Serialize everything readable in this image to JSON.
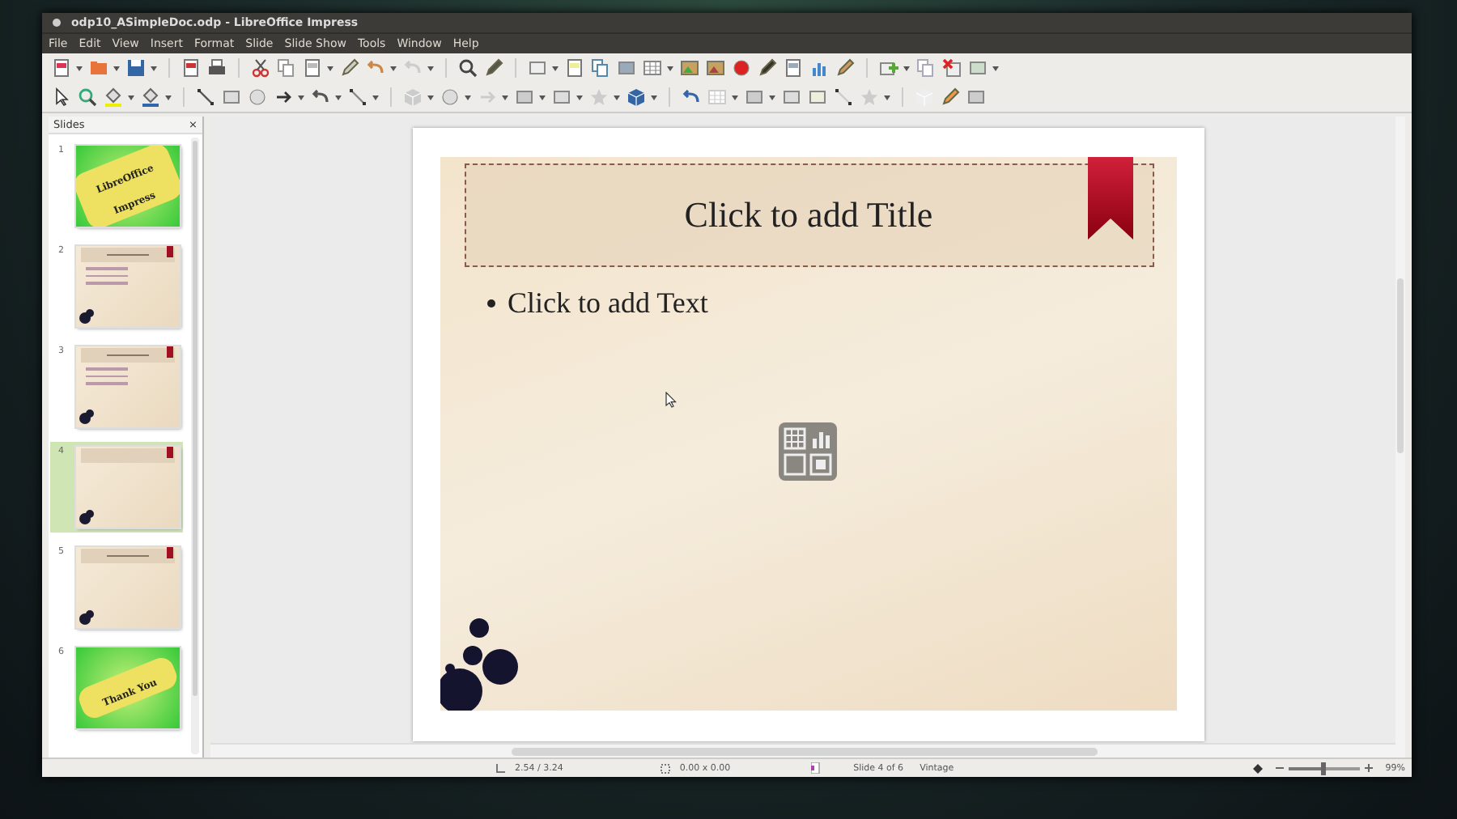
{
  "window": {
    "title": "odp10_ASimpleDoc.odp - LibreOffice Impress"
  },
  "menu": [
    "File",
    "Edit",
    "View",
    "Insert",
    "Format",
    "Slide",
    "Slide Show",
    "Tools",
    "Window",
    "Help"
  ],
  "slides_pane": {
    "title": "Slides",
    "close": "×",
    "slides": [
      {
        "number": "1",
        "kind": "cover",
        "text": "LibreOffice Impress",
        "selected": false
      },
      {
        "number": "2",
        "kind": "content",
        "selected": false
      },
      {
        "number": "3",
        "kind": "content",
        "selected": false
      },
      {
        "number": "4",
        "kind": "empty",
        "selected": true
      },
      {
        "number": "5",
        "kind": "title",
        "selected": false
      },
      {
        "number": "6",
        "kind": "cover",
        "text": "Thank You",
        "selected": false
      }
    ]
  },
  "slide": {
    "title_placeholder": "Click to add Title",
    "text_placeholder": "Click to add Text"
  },
  "status_bar": {
    "position": "2.54 / 3.24",
    "size": "0.00 x 0.00",
    "slide": "Slide 4 of 6",
    "master": "Vintage",
    "zoom_slider": {
      "level": 0.5
    },
    "zoom": "99%"
  }
}
